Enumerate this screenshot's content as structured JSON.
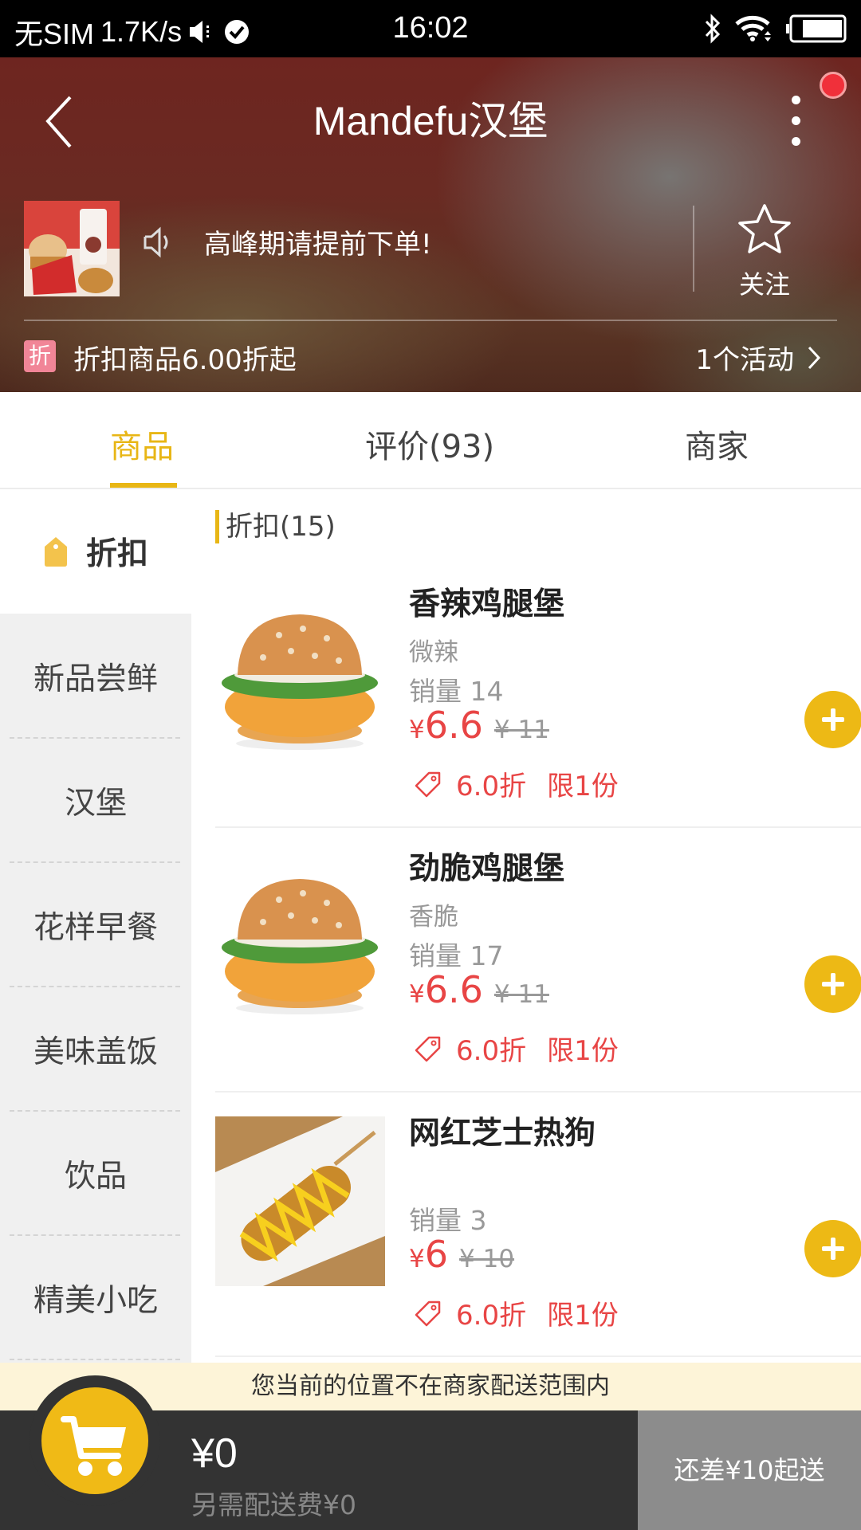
{
  "status_bar": {
    "carrier": "无SIM",
    "speed": "1.7K/s",
    "time": "16:02",
    "icons": [
      "mute-icon",
      "check-circle-icon",
      "bluetooth-icon",
      "wifi-icon",
      "battery-icon"
    ]
  },
  "header": {
    "title": "Mandefu汉堡",
    "notice": "高峰期请提前下单!",
    "follow_label": "关注",
    "promo_badge": "折",
    "promo_text": "折扣商品6.00折起",
    "activity_label": "1个活动",
    "has_notification_dot": true
  },
  "tabs": [
    {
      "label": "商品",
      "active": true
    },
    {
      "label": "评价(93)",
      "active": false
    },
    {
      "label": "商家",
      "active": false
    }
  ],
  "sidebar": {
    "items": [
      {
        "label": "折扣",
        "active": true,
        "icon": "tag-icon"
      },
      {
        "label": "新品尝鲜",
        "active": false
      },
      {
        "label": "汉堡",
        "active": false
      },
      {
        "label": "花样早餐",
        "active": false
      },
      {
        "label": "美味盖饭",
        "active": false
      },
      {
        "label": "饮品",
        "active": false
      },
      {
        "label": "精美小吃",
        "active": false
      }
    ]
  },
  "section": {
    "title": "折扣(15)"
  },
  "products": [
    {
      "name": "香辣鸡腿堡",
      "desc": "微辣",
      "sales": "销量 14",
      "currency": "¥",
      "price": "6.6",
      "original_price": "¥ 11",
      "discount": "6.0折",
      "limit": "限1份",
      "image": "spicy-chicken-burger"
    },
    {
      "name": "劲脆鸡腿堡",
      "desc": "香脆",
      "sales": "销量 17",
      "currency": "¥",
      "price": "6.6",
      "original_price": "¥ 11",
      "discount": "6.0折",
      "limit": "限1份",
      "image": "crispy-chicken-burger"
    },
    {
      "name": "网红芝士热狗",
      "desc": "",
      "sales": "销量 3",
      "currency": "¥",
      "price": "6",
      "original_price": "¥ 10",
      "discount": "6.0折",
      "limit": "限1份",
      "image": "cheese-corn-dog"
    }
  ],
  "range_notice": "您当前的位置不在商家配送范围内",
  "cart": {
    "total": "¥0",
    "delivery_fee": "另需配送费¥0",
    "checkout_label": "还差¥10起送"
  },
  "colors": {
    "accent": "#e8b615",
    "price_red": "#e84545",
    "promo_pink": "#f18597",
    "bottom_bar": "#333333",
    "checkout_disabled": "#8c8c8c",
    "notice_bg": "#fdf4d8"
  }
}
